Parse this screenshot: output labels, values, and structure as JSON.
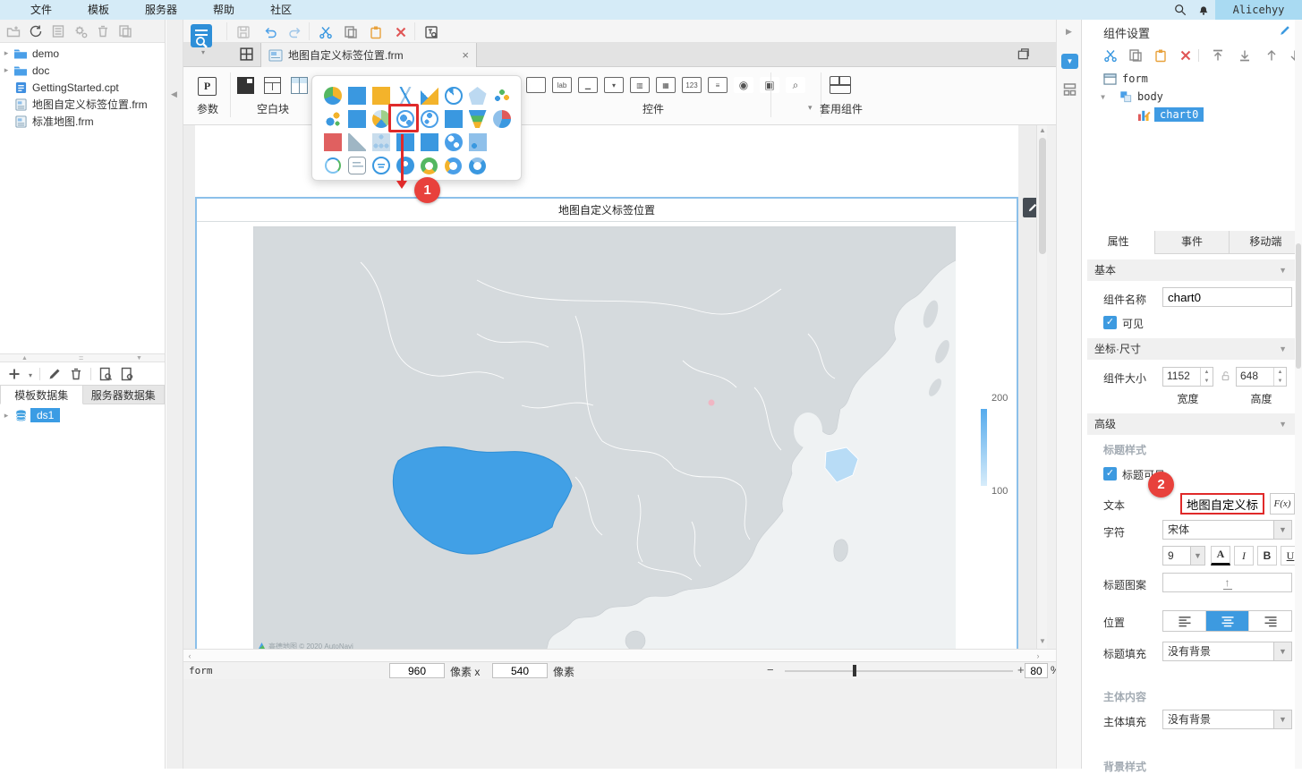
{
  "menu": {
    "items": [
      "文件",
      "模板",
      "服务器",
      "帮助",
      "社区"
    ],
    "user": "Alicehyy"
  },
  "left_toolbar": {
    "icons": [
      "new-template",
      "refresh",
      "template-doc",
      "template-settings",
      "delete-template",
      "copy-template"
    ]
  },
  "file_tree": {
    "items": [
      {
        "label": "demo",
        "icon": "folder",
        "expandable": true
      },
      {
        "label": "doc",
        "icon": "folder",
        "expandable": true
      },
      {
        "label": "GettingStarted.cpt",
        "icon": "cpt-file",
        "expandable": false
      },
      {
        "label": "地图自定义标签位置.frm",
        "icon": "frm-file",
        "expandable": false
      },
      {
        "label": "标准地图.frm",
        "icon": "frm-file",
        "expandable": false
      }
    ]
  },
  "dataset_panel": {
    "toolbar_icons": [
      "add",
      "caret",
      "edit",
      "trash",
      "preview-doc",
      "doc-settings"
    ],
    "tabs": [
      {
        "label": "模板数据集",
        "active": true
      },
      {
        "label": "服务器数据集",
        "active": false
      }
    ],
    "items": [
      {
        "label": "ds1",
        "icon": "database"
      }
    ]
  },
  "main_toolbar": {
    "icons": [
      "save",
      "undo",
      "redo",
      "cut",
      "copy",
      "paste",
      "delete",
      "find-replace"
    ]
  },
  "tab_bar": {
    "tab_label": "地图自定义标签位置.frm"
  },
  "ribbon": {
    "param_label": "参数",
    "blank_label": "空白块",
    "widget_label": "控件",
    "reuse_label": "套用组件"
  },
  "widget_icons": [
    {
      "name": "textbox",
      "char": ""
    },
    {
      "name": "label",
      "char": "lab"
    },
    {
      "name": "button",
      "char": "▁"
    },
    {
      "name": "dropdown",
      "char": "▾"
    },
    {
      "name": "tree",
      "char": "▥"
    },
    {
      "name": "date",
      "char": "▦"
    },
    {
      "name": "number",
      "char": "123"
    },
    {
      "name": "textarea",
      "char": "≡"
    },
    {
      "name": "radio",
      "char": "◉",
      "bare": true
    },
    {
      "name": "checkbox",
      "char": "▣",
      "bare": true
    },
    {
      "name": "preview",
      "char": "⌕",
      "bare": true
    }
  ],
  "chart_palette": {
    "rows": [
      [
        {
          "name": "pie"
        },
        {
          "name": "column"
        },
        {
          "name": "bar"
        },
        {
          "name": "line"
        },
        {
          "name": "area"
        },
        {
          "name": "gauge"
        },
        {
          "name": "radar"
        },
        {
          "name": "scatter"
        }
      ],
      [
        {
          "name": "bubble"
        },
        {
          "name": "combo"
        },
        {
          "name": "multi-pie"
        },
        {
          "name": "map",
          "selected": true
        },
        {
          "name": "drill-map"
        },
        {
          "name": "treemap"
        },
        {
          "name": "funnel"
        },
        {
          "name": "gis-map"
        }
      ],
      [
        {
          "name": "gantt"
        },
        {
          "name": "milestone"
        },
        {
          "name": "org-tree"
        },
        {
          "name": "box-plot"
        },
        {
          "name": "point-map"
        },
        {
          "name": "world-map"
        },
        {
          "name": "flag-map"
        }
      ],
      [
        {
          "name": "dial"
        },
        {
          "name": "word-cloud"
        },
        {
          "name": "kpi-card"
        },
        {
          "name": "contact"
        },
        {
          "name": "ring"
        },
        {
          "name": "donut"
        },
        {
          "name": "circle-pack"
        }
      ]
    ]
  },
  "annotations": {
    "step1": "1",
    "step2": "2"
  },
  "canvas": {
    "chart_title": "地图自定义标签位置",
    "legend": {
      "max": "200",
      "min": "100"
    },
    "map": {
      "attribution": "高德地图 © 2020 AutoNavi",
      "highlight_color": "#41a0e6",
      "land_color": "#d5dadd"
    }
  },
  "status_bar": {
    "form_label": "form",
    "width_value": "960",
    "px_x_label": "像素 x",
    "height_value": "540",
    "px_label": "像素",
    "zoom_value": "80",
    "percent_label": "%"
  },
  "right_panel": {
    "header": "组件设置",
    "toolbar_icons": [
      "cut",
      "copy",
      "paste",
      "delete",
      "move-top",
      "move-bottom",
      "move-up",
      "move-down"
    ],
    "tree": {
      "root": "form",
      "child": "body",
      "leaf": "chart0"
    },
    "tabs": [
      {
        "label": "属性",
        "active": true
      },
      {
        "label": "事件",
        "active": false
      },
      {
        "label": "移动端",
        "active": false
      }
    ],
    "basic": {
      "title": "基本",
      "name_label": "组件名称",
      "name_value": "chart0",
      "visible_label": "可见",
      "visible_checked": "✓"
    },
    "coord": {
      "title": "坐标·尺寸",
      "size_label": "组件大小",
      "width_value": "1152",
      "width_label": "宽度",
      "height_value": "648",
      "height_label": "高度"
    },
    "advanced": {
      "title": "高级"
    },
    "title_style": {
      "section_label": "标题样式",
      "visible_label": "标题可见",
      "visible_checked": "✓",
      "text_label": "文本",
      "text_value": "地图自定义标签位置",
      "fx_label": "F(x)",
      "font_label": "字符",
      "font_value": "宋体",
      "font_size_value": "9",
      "color_btn": "A",
      "italic_btn": "I",
      "bold_btn": "B",
      "underline_btn": "U",
      "pattern_label": "标题图案",
      "position_label": "位置",
      "fill_label": "标题填充",
      "fill_value": "没有背景"
    },
    "body_content": {
      "section_label": "主体内容",
      "fill_label": "主体填充",
      "fill_value": "没有背景"
    },
    "bg_style": {
      "section_label": "背景样式"
    }
  }
}
